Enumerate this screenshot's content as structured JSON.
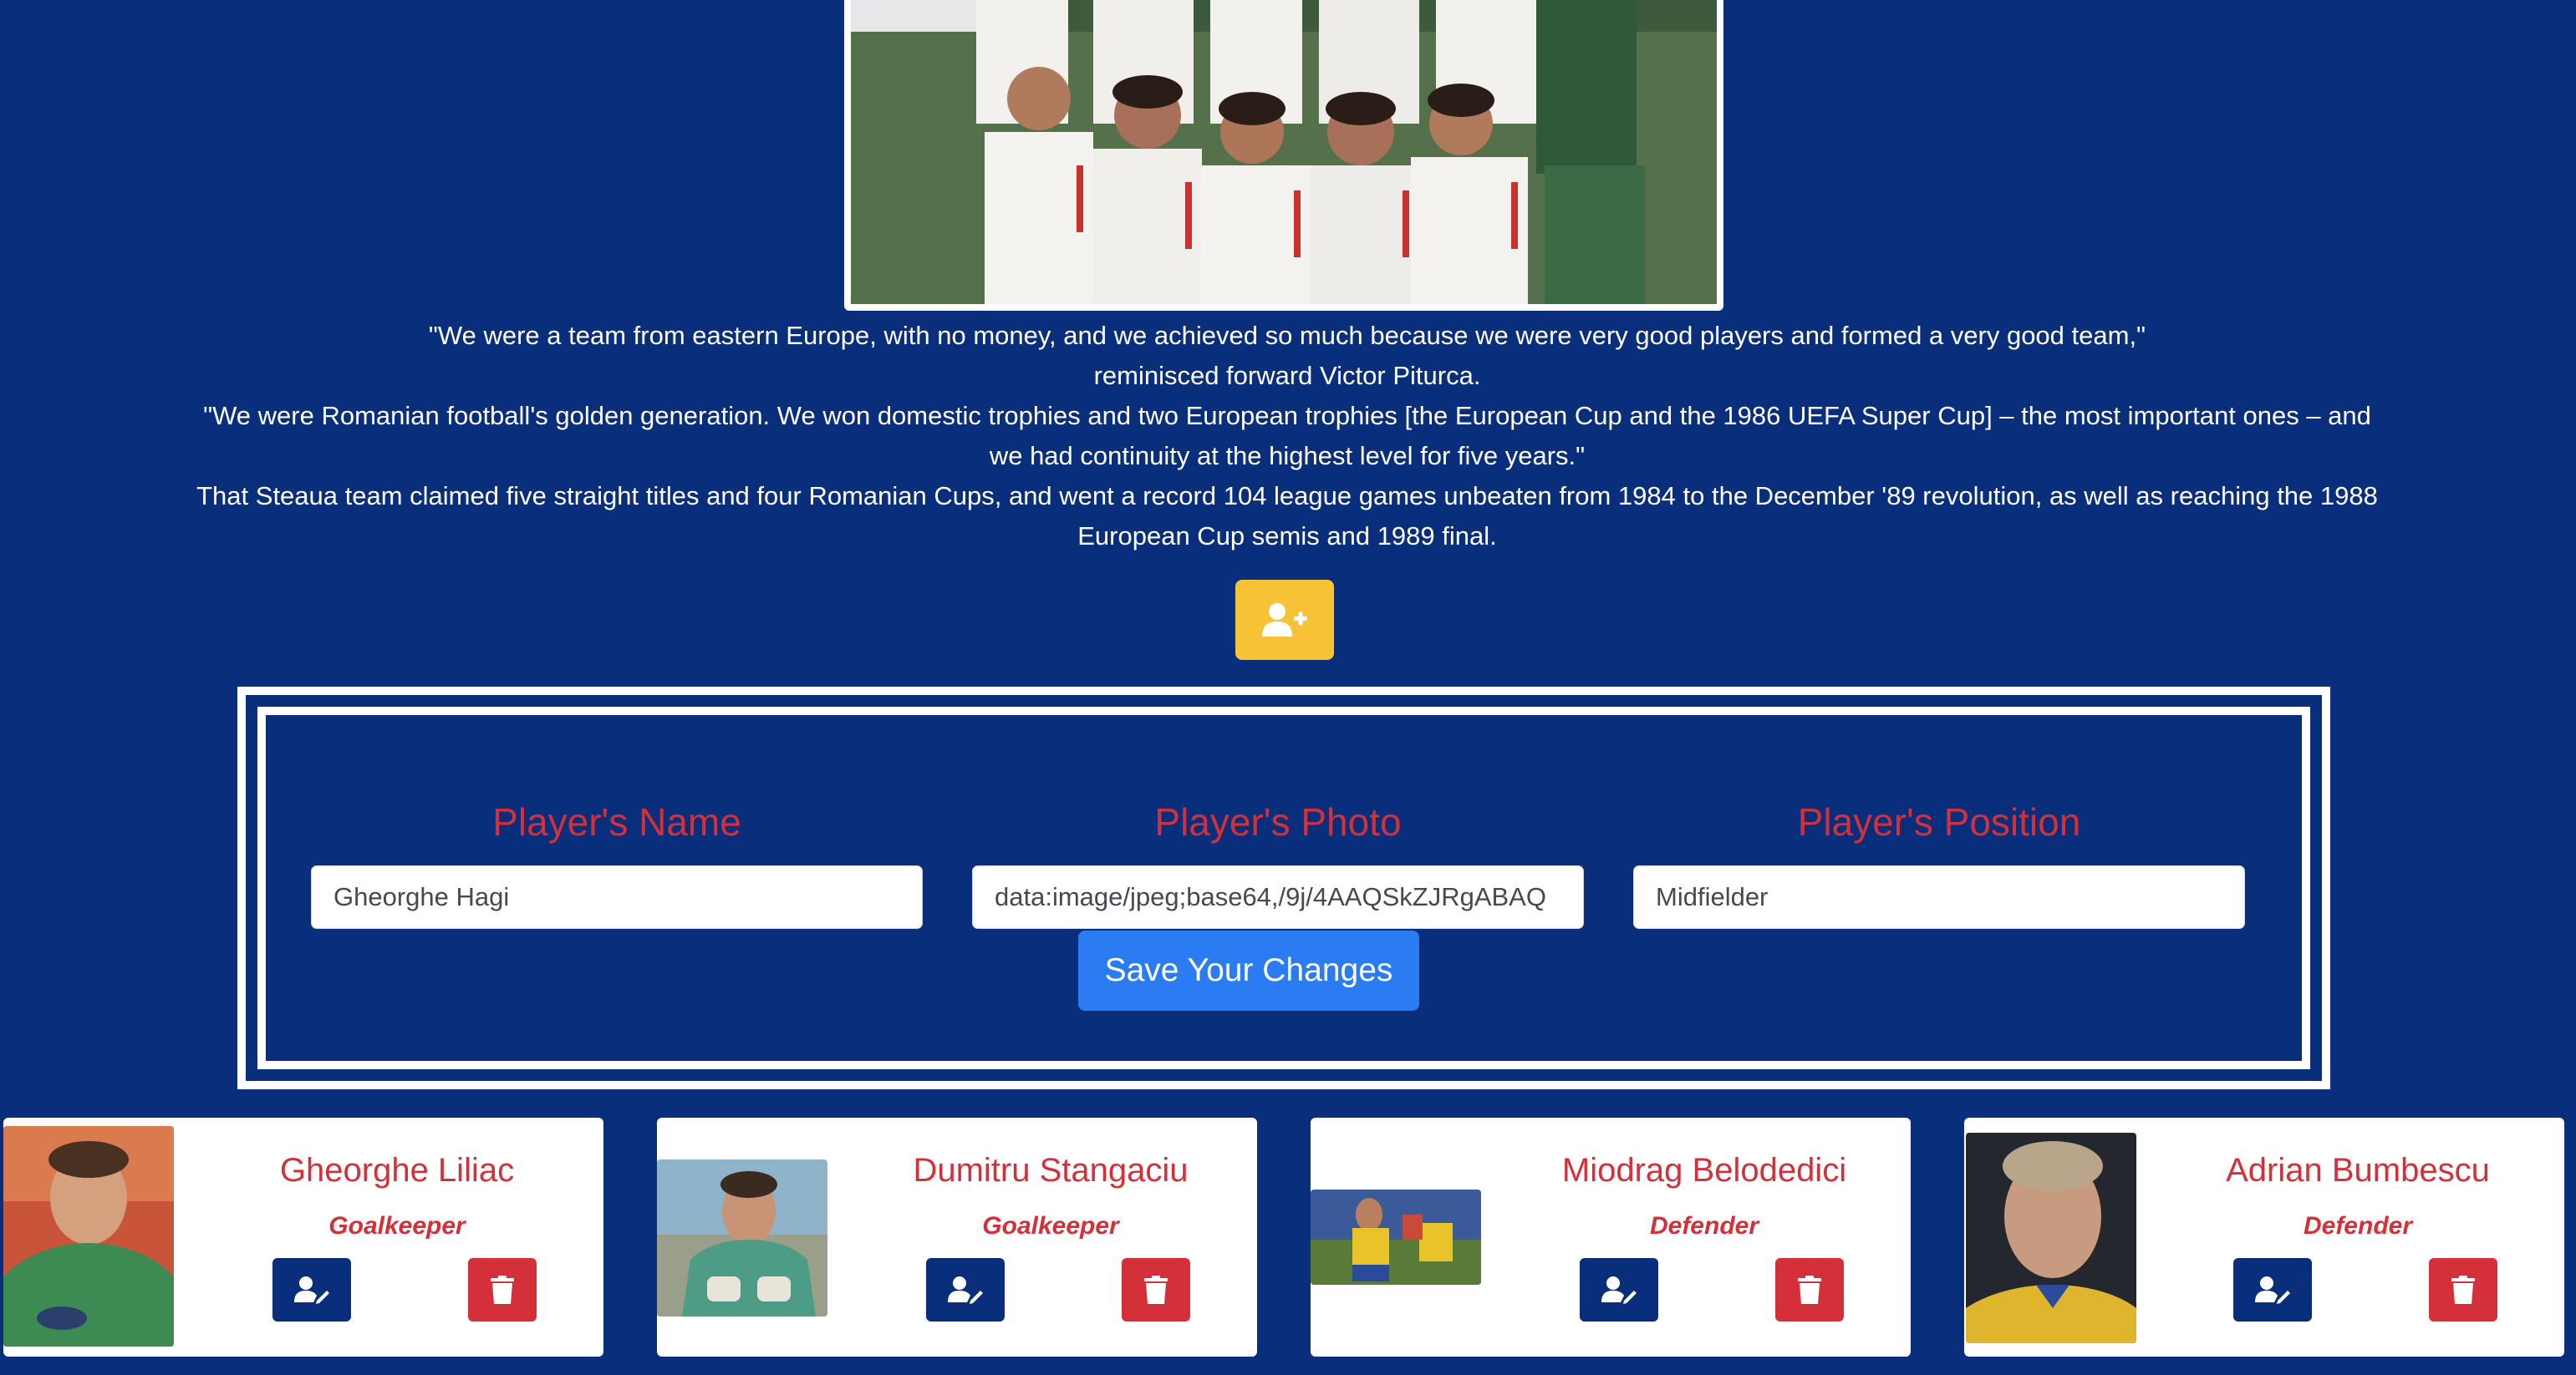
{
  "colors": {
    "background": "#082e7c",
    "accent_red": "#d3303a",
    "add_button": "#f7c236",
    "save_button": "#2b7cf2",
    "text": "#ffffff"
  },
  "team_photo": {
    "description_icon": "team-photo-image"
  },
  "quote": {
    "line1": "\"We were a team from eastern Europe, with no money, and we achieved so much because we were very good players and formed a very good team,\"",
    "line2": "reminisced forward Victor Piturca.",
    "line3": "\"We were Romanian football's golden generation. We won domestic trophies and two European trophies [the European Cup and the 1986 UEFA Super Cup] – the most important ones – and",
    "line4": "we had continuity at the highest level for five years.\"",
    "line5": "That Steaua team claimed five straight titles and four Romanian Cups, and went a record 104 league games unbeaten from 1984 to the December '89 revolution, as well as reaching the 1988",
    "line6": "European Cup semis and 1989 final."
  },
  "add_player_button": {
    "icon": "user-plus-icon"
  },
  "form": {
    "name_label": "Player's Name",
    "name_value": "Gheorghe Hagi",
    "photo_label": "Player's Photo",
    "photo_value": "data:image/jpeg;base64,/9j/4AAQSkZJRgABAQ",
    "position_label": "Player's Position",
    "position_value": "Midfielder",
    "save_label": "Save Your Changes"
  },
  "players": [
    {
      "name": "Gheorghe Liliac",
      "position": "Goalkeeper",
      "edit_icon": "user-edit-icon",
      "delete_icon": "trash-icon"
    },
    {
      "name": "Dumitru Stangaciu",
      "position": "Goalkeeper",
      "edit_icon": "user-edit-icon",
      "delete_icon": "trash-icon"
    },
    {
      "name": "Miodrag Belodedici",
      "position": "Defender",
      "edit_icon": "user-edit-icon",
      "delete_icon": "trash-icon"
    },
    {
      "name": "Adrian Bumbescu",
      "position": "Defender",
      "edit_icon": "user-edit-icon",
      "delete_icon": "trash-icon"
    }
  ]
}
